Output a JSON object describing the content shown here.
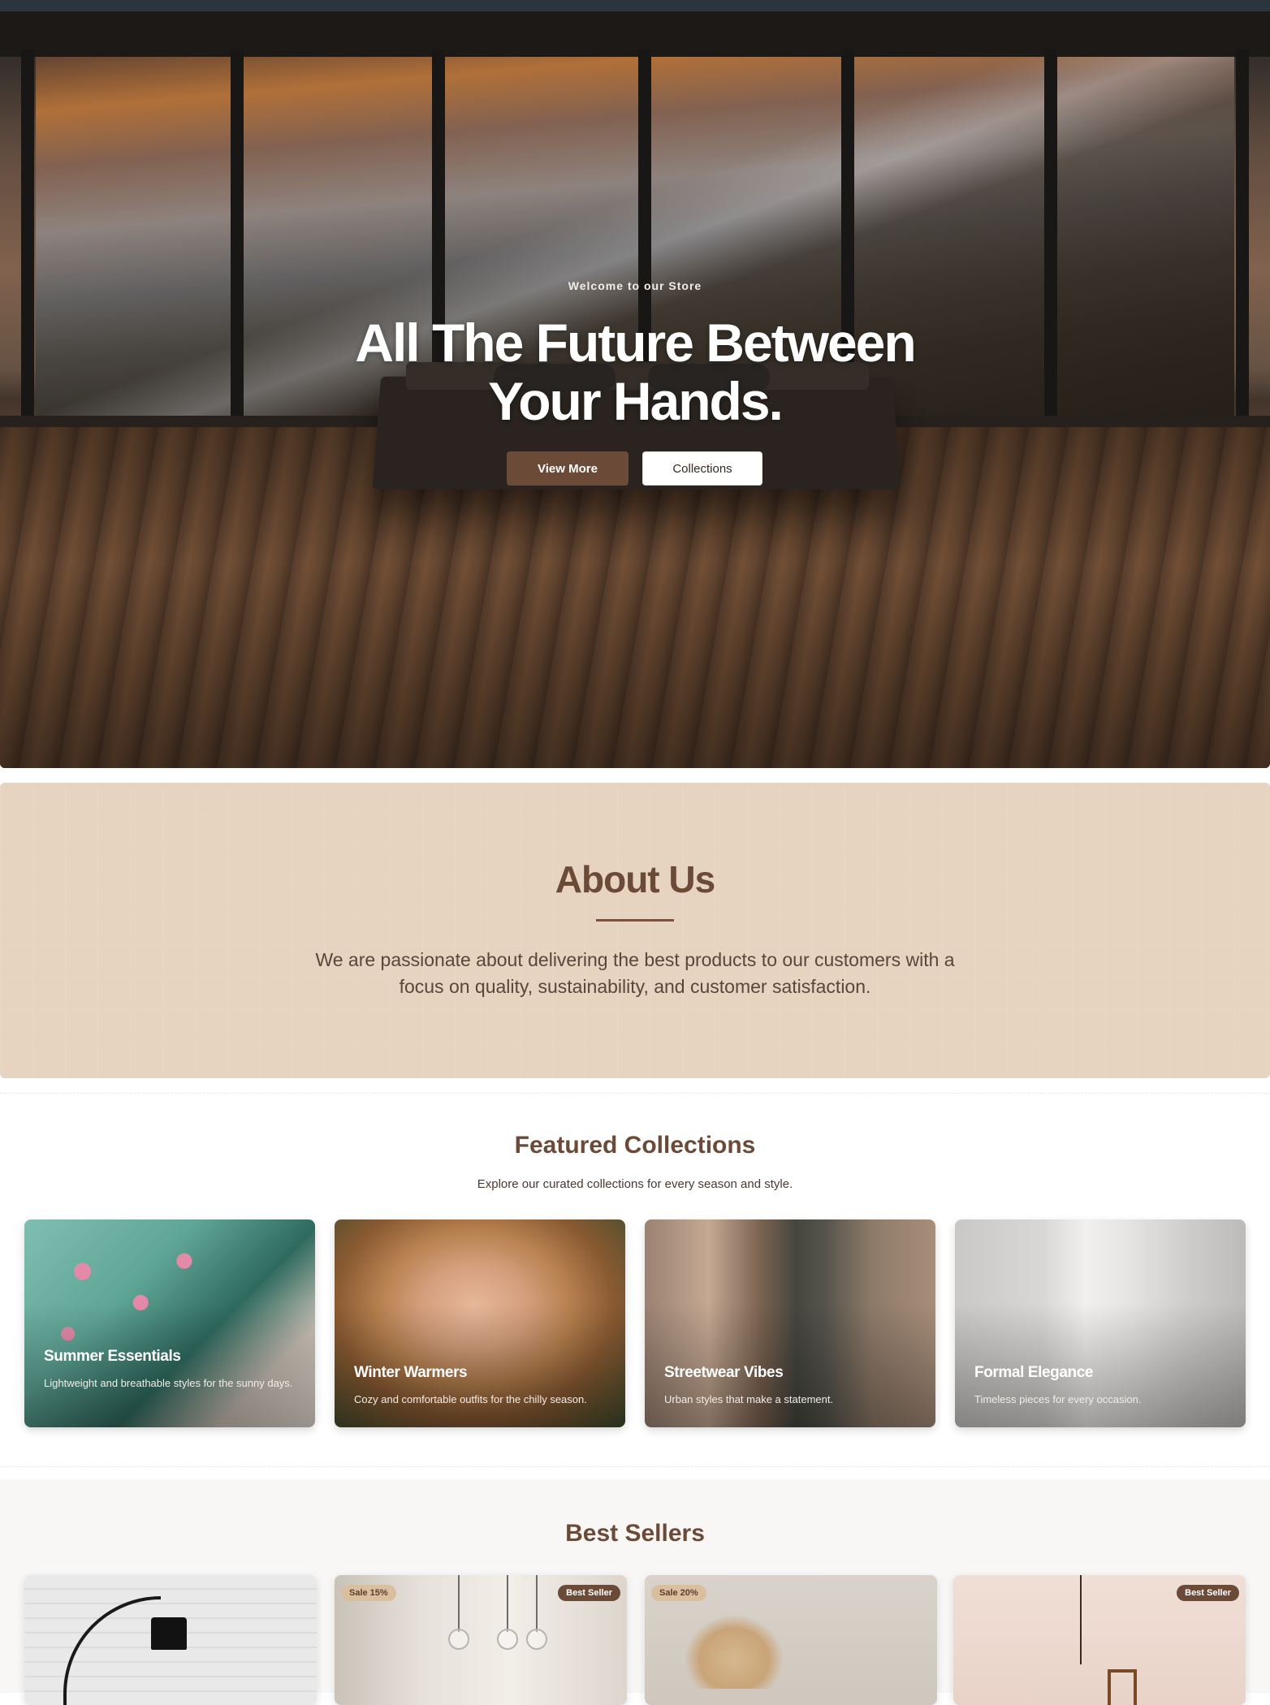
{
  "hero": {
    "kicker": "Welcome to our Store",
    "title_line1": "All The Future Between",
    "title_line2": "Your Hands.",
    "btn_primary": "View More",
    "btn_secondary": "Collections"
  },
  "about": {
    "title": "About Us",
    "text": "We are passionate about delivering the best products to our customers with a focus on quality, sustainability, and customer satisfaction."
  },
  "featured": {
    "title": "Featured Collections",
    "subtitle": "Explore our curated collections for every season and style.",
    "items": [
      {
        "title": "Summer Essentials",
        "desc": "Lightweight and breathable styles for the sunny days."
      },
      {
        "title": "Winter Warmers",
        "desc": "Cozy and comfortable outfits for the chilly season."
      },
      {
        "title": "Streetwear Vibes",
        "desc": "Urban styles that make a statement."
      },
      {
        "title": "Formal Elegance",
        "desc": "Timeless pieces for every occasion."
      }
    ]
  },
  "best_sellers": {
    "title": "Best Sellers",
    "items": [
      {
        "sale_badge": "",
        "best_badge": ""
      },
      {
        "sale_badge": "Sale 15%",
        "best_badge": "Best Seller"
      },
      {
        "sale_badge": "Sale 20%",
        "best_badge": ""
      },
      {
        "sale_badge": "",
        "best_badge": "Best Seller"
      }
    ]
  },
  "colors": {
    "brand_brown": "#6b4a38",
    "about_bg": "#e6d4c0",
    "badge_sale_bg": "#d9bf9e"
  }
}
